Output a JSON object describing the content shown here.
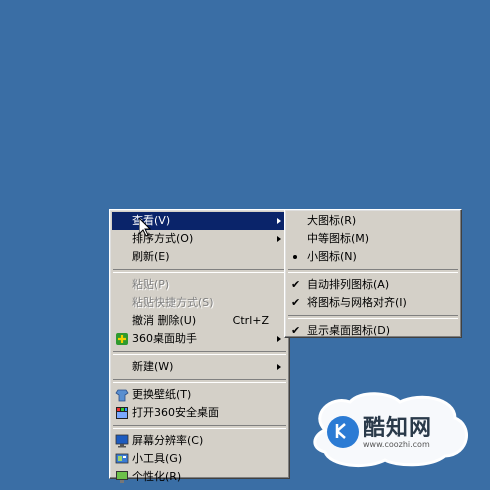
{
  "context_menu": {
    "items": [
      {
        "label": "查看(V)",
        "arrow": true,
        "highlight": true
      },
      {
        "label": "排序方式(O)",
        "arrow": true
      },
      {
        "label": "刷新(E)"
      },
      {
        "label": "粘贴(P)",
        "disabled": true
      },
      {
        "label": "粘贴快捷方式(S)",
        "disabled": true
      },
      {
        "label": "撤消 删除(U)",
        "shortcut": "Ctrl+Z"
      },
      {
        "label": "360桌面助手",
        "arrow": true,
        "icon": "360-assistant-icon"
      },
      {
        "label": "新建(W)",
        "arrow": true
      },
      {
        "label": "更换壁纸(T)",
        "icon": "wallpaper-icon"
      },
      {
        "label": "打开360安全桌面",
        "icon": "360-desktop-icon"
      },
      {
        "label": "屏幕分辨率(C)",
        "icon": "monitor-icon"
      },
      {
        "label": "小工具(G)",
        "icon": "gadgets-icon"
      },
      {
        "label": "个性化(R)",
        "icon": "personalize-icon"
      }
    ]
  },
  "view_submenu": {
    "items": [
      {
        "label": "大图标(R)"
      },
      {
        "label": "中等图标(M)"
      },
      {
        "label": "小图标(N)",
        "selected": true
      },
      {
        "label": "自动排列图标(A)",
        "checked": true
      },
      {
        "label": "将图标与网格对齐(I)",
        "checked": true
      },
      {
        "label": "显示桌面图标(D)",
        "checked": true
      }
    ]
  },
  "watermark": {
    "title": "酷知网",
    "url": "www.coozhi.com"
  },
  "colors": {
    "desktop": "#3a6ea5",
    "menu": "#d4d0c8",
    "highlight": "#0a246a"
  }
}
